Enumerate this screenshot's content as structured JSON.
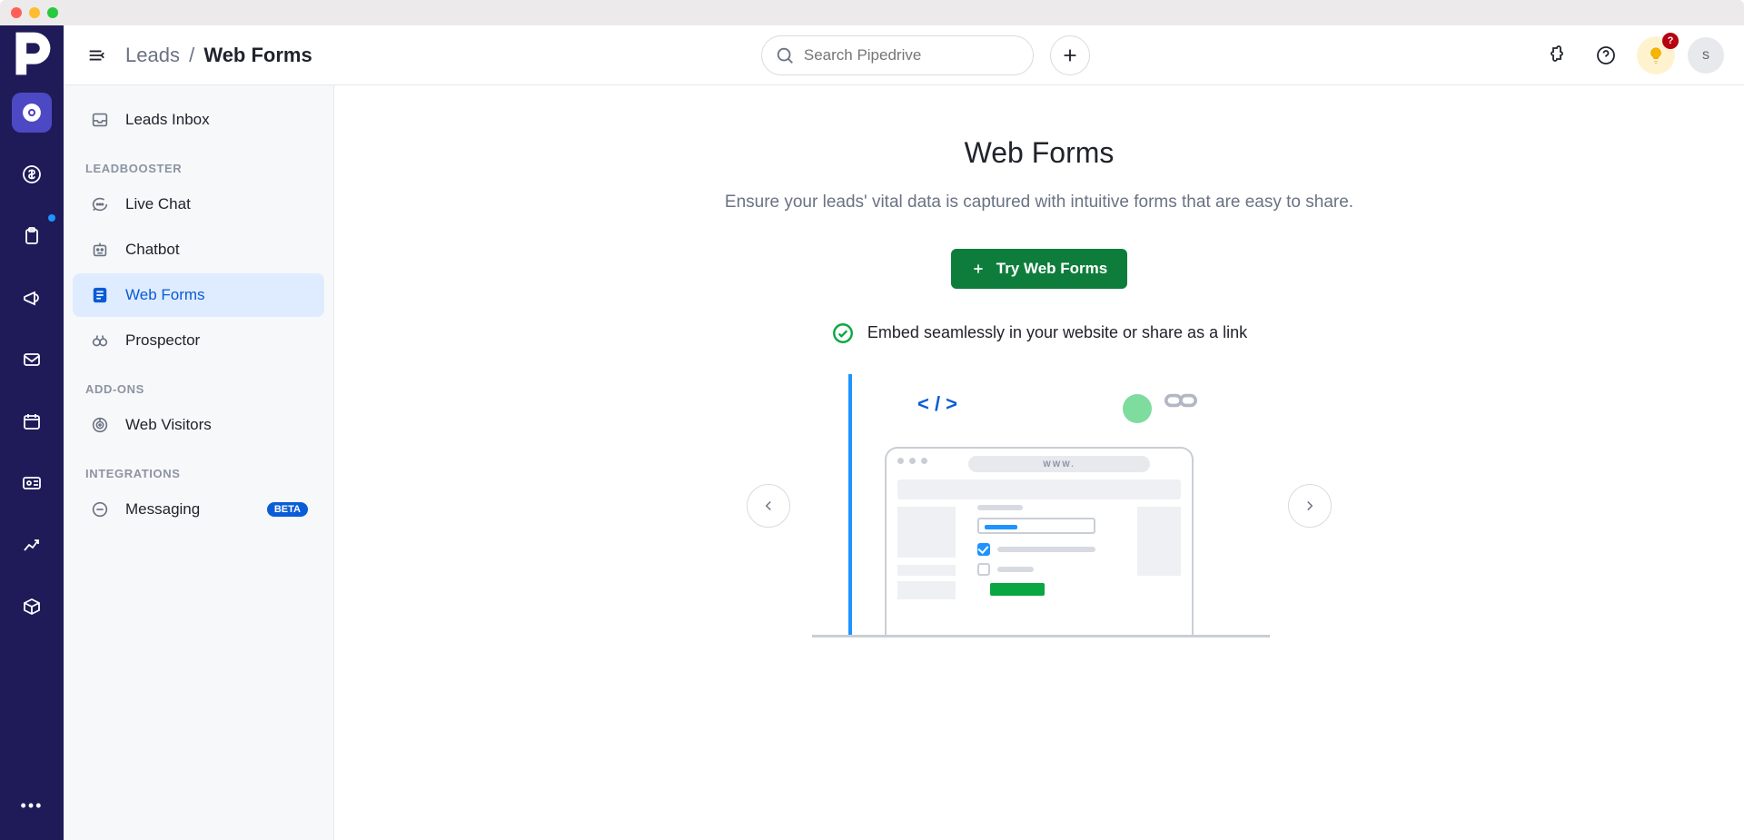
{
  "window": {
    "controls": [
      "close",
      "minimize",
      "maximize"
    ]
  },
  "breadcrumb": {
    "parent": "Leads",
    "sep": "/",
    "current": "Web Forms"
  },
  "search": {
    "placeholder": "Search Pipedrive",
    "value": ""
  },
  "topbar": {
    "help_badge": "?",
    "avatar_initial": "s"
  },
  "rail": {
    "items": [
      {
        "name": "leads",
        "active": true
      },
      {
        "name": "deals"
      },
      {
        "name": "activities",
        "indicator": true
      },
      {
        "name": "campaigns"
      },
      {
        "name": "mail"
      },
      {
        "name": "calendar"
      },
      {
        "name": "contacts"
      },
      {
        "name": "insights"
      },
      {
        "name": "products"
      }
    ]
  },
  "sidebar": {
    "items_top": [
      {
        "label": "Leads Inbox",
        "icon": "inbox"
      }
    ],
    "section1_title": "LEADBOOSTER",
    "items1": [
      {
        "label": "Live Chat",
        "icon": "chat"
      },
      {
        "label": "Chatbot",
        "icon": "bot"
      },
      {
        "label": "Web Forms",
        "icon": "form",
        "active": true
      },
      {
        "label": "Prospector",
        "icon": "binoc"
      }
    ],
    "section2_title": "ADD-ONS",
    "items2": [
      {
        "label": "Web Visitors",
        "icon": "radar"
      }
    ],
    "section3_title": "INTEGRATIONS",
    "items3": [
      {
        "label": "Messaging",
        "icon": "message",
        "badge": "BETA"
      }
    ]
  },
  "content": {
    "title": "Web Forms",
    "subtitle": "Ensure your leads' vital data is captured with intuitive forms that are easy to share.",
    "cta_label": "Try Web Forms",
    "feature_line": "Embed seamlessly in your website or share as a link",
    "illus": {
      "code_label": "< / >",
      "url_label": "WWW."
    }
  }
}
